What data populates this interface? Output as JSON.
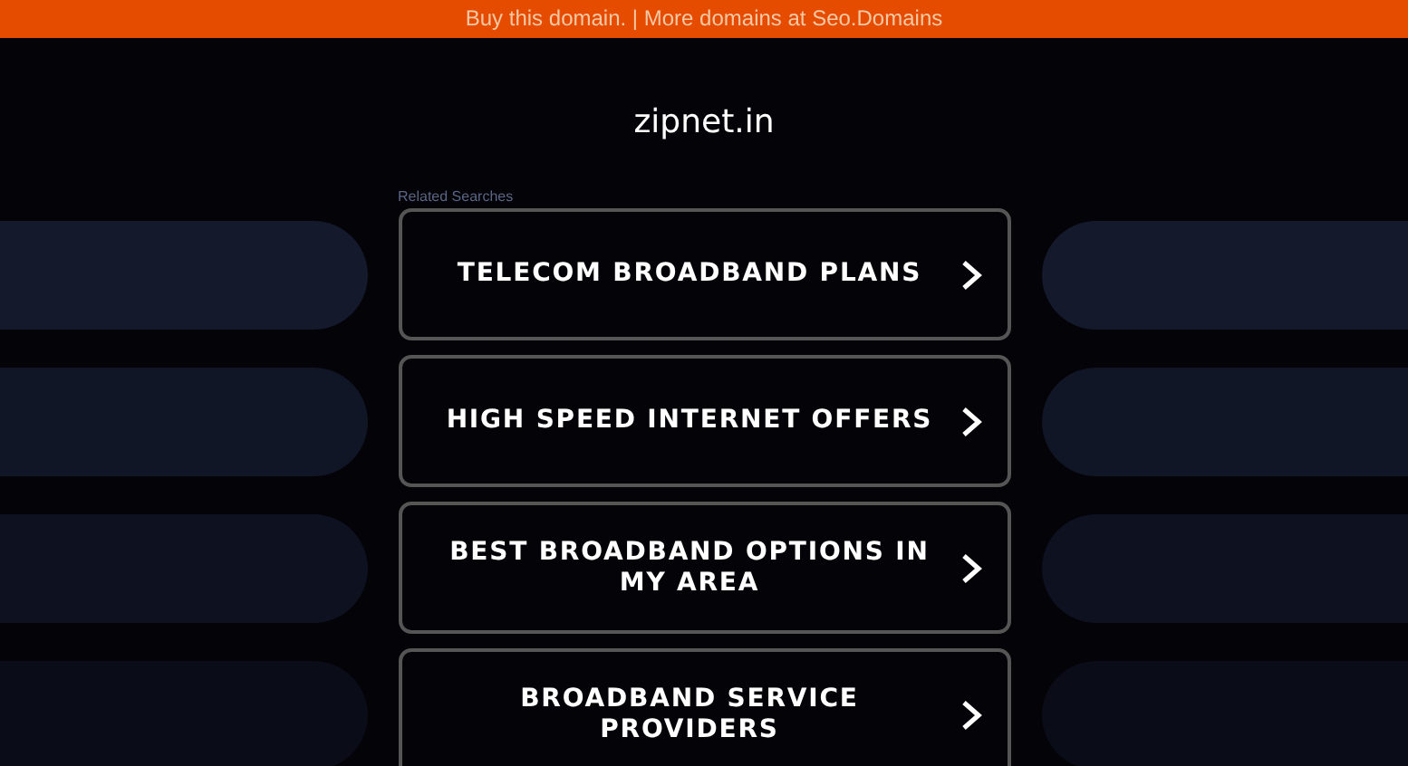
{
  "top_banner": {
    "text": "Buy this domain. | More domains at Seo.Domains"
  },
  "site_title": "zipnet.in",
  "related_label": "Related Searches",
  "links": [
    {
      "label": "TELECOM BROADBAND PLANS"
    },
    {
      "label": "HIGH SPEED INTERNET OFFERS"
    },
    {
      "label": "BEST BROADBAND OPTIONS IN MY AREA"
    },
    {
      "label": "BROADBAND SERVICE PROVIDERS"
    }
  ]
}
